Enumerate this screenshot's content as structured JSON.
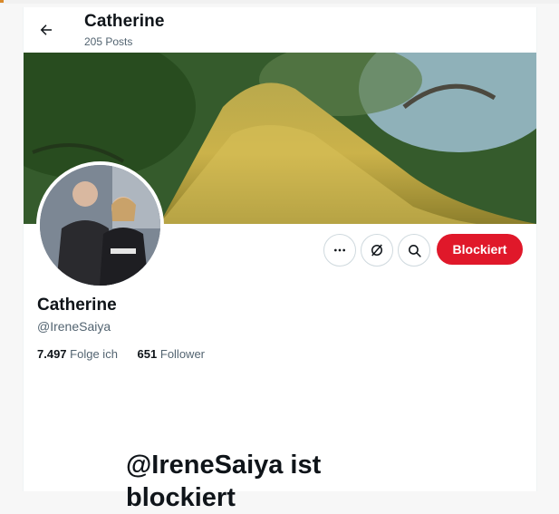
{
  "header": {
    "name": "Catherine",
    "posts": "205 Posts"
  },
  "profile": {
    "display_name": "Catherine",
    "handle": "@IreneSaiya",
    "following_count": "7.497",
    "following_label": "Folge ich",
    "followers_count": "651",
    "followers_label": "Follower"
  },
  "actions": {
    "blocked_label": "Blockiert"
  },
  "blocked_notice": {
    "title_line1": "@IreneSaiya ist",
    "title_line2": "blockiert"
  },
  "colors": {
    "accent_red": "#e0182a",
    "text_primary": "#0f1419",
    "text_secondary": "#536471",
    "border": "#cfd9de"
  },
  "icons": {
    "back": "arrow-left-icon",
    "more": "more-dots-icon",
    "grok": "grok-slash-circle-icon",
    "search": "search-icon"
  }
}
